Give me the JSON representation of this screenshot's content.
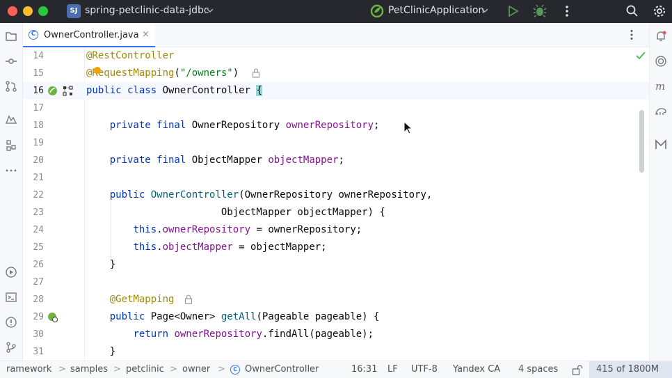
{
  "titlebar": {
    "project_badge": "SJ",
    "project_name": "spring-petclinic-data-jdbc",
    "run_config": "PetClinicApplication"
  },
  "tab": {
    "label": "OwnerController.java",
    "close": "×",
    "file_icon_letter": "C"
  },
  "editor": {
    "lines": [
      {
        "num": "14",
        "text": "@RestController"
      },
      {
        "num": "15",
        "text": "@RequestMapping(\"/owners\")"
      },
      {
        "num": "16",
        "text": "public class OwnerController {"
      },
      {
        "num": "17",
        "text": ""
      },
      {
        "num": "18",
        "text": "    private final OwnerRepository ownerRepository;"
      },
      {
        "num": "19",
        "text": ""
      },
      {
        "num": "20",
        "text": "    private final ObjectMapper objectMapper;"
      },
      {
        "num": "21",
        "text": ""
      },
      {
        "num": "22",
        "text": "    public OwnerController(OwnerRepository ownerRepository,"
      },
      {
        "num": "23",
        "text": "                           ObjectMapper objectMapper) {"
      },
      {
        "num": "24",
        "text": "        this.ownerRepository = ownerRepository;"
      },
      {
        "num": "25",
        "text": "        this.objectMapper = objectMapper;"
      },
      {
        "num": "26",
        "text": "    }"
      },
      {
        "num": "27",
        "text": ""
      },
      {
        "num": "28",
        "text": "    @GetMapping"
      },
      {
        "num": "29",
        "text": "    public Page<Owner> getAll(Pageable pageable) {"
      },
      {
        "num": "30",
        "text": "        return ownerRepository.findAll(pageable);"
      },
      {
        "num": "31",
        "text": "    }"
      }
    ]
  },
  "statusbar": {
    "breadcrumbs": [
      "ramework",
      "samples",
      "petclinic",
      "owner",
      "OwnerController"
    ],
    "separator": ">",
    "position": "16:31",
    "line_ending": "LF",
    "encoding": "UTF-8",
    "keymap": "Yandex CA",
    "indent": "4 spaces",
    "memory": "415 of 1800M"
  },
  "colors": {
    "keyword": "#0033b3",
    "annotation": "#9e880d",
    "string": "#067d17",
    "field": "#871094",
    "method": "#00627a",
    "accent": "#3574f0"
  },
  "icons": {
    "left_strip": [
      "folder-icon",
      "commit-icon",
      "pull-requests-icon",
      "learn-icon",
      "structure-icon",
      "more-tools-icon",
      "services-icon",
      "terminal-icon",
      "problems-icon",
      "git-icon"
    ],
    "right_strip": [
      "notifications-icon",
      "ai-assistant-icon",
      "maven-icon",
      "gradle-icon",
      "database-icon"
    ]
  }
}
